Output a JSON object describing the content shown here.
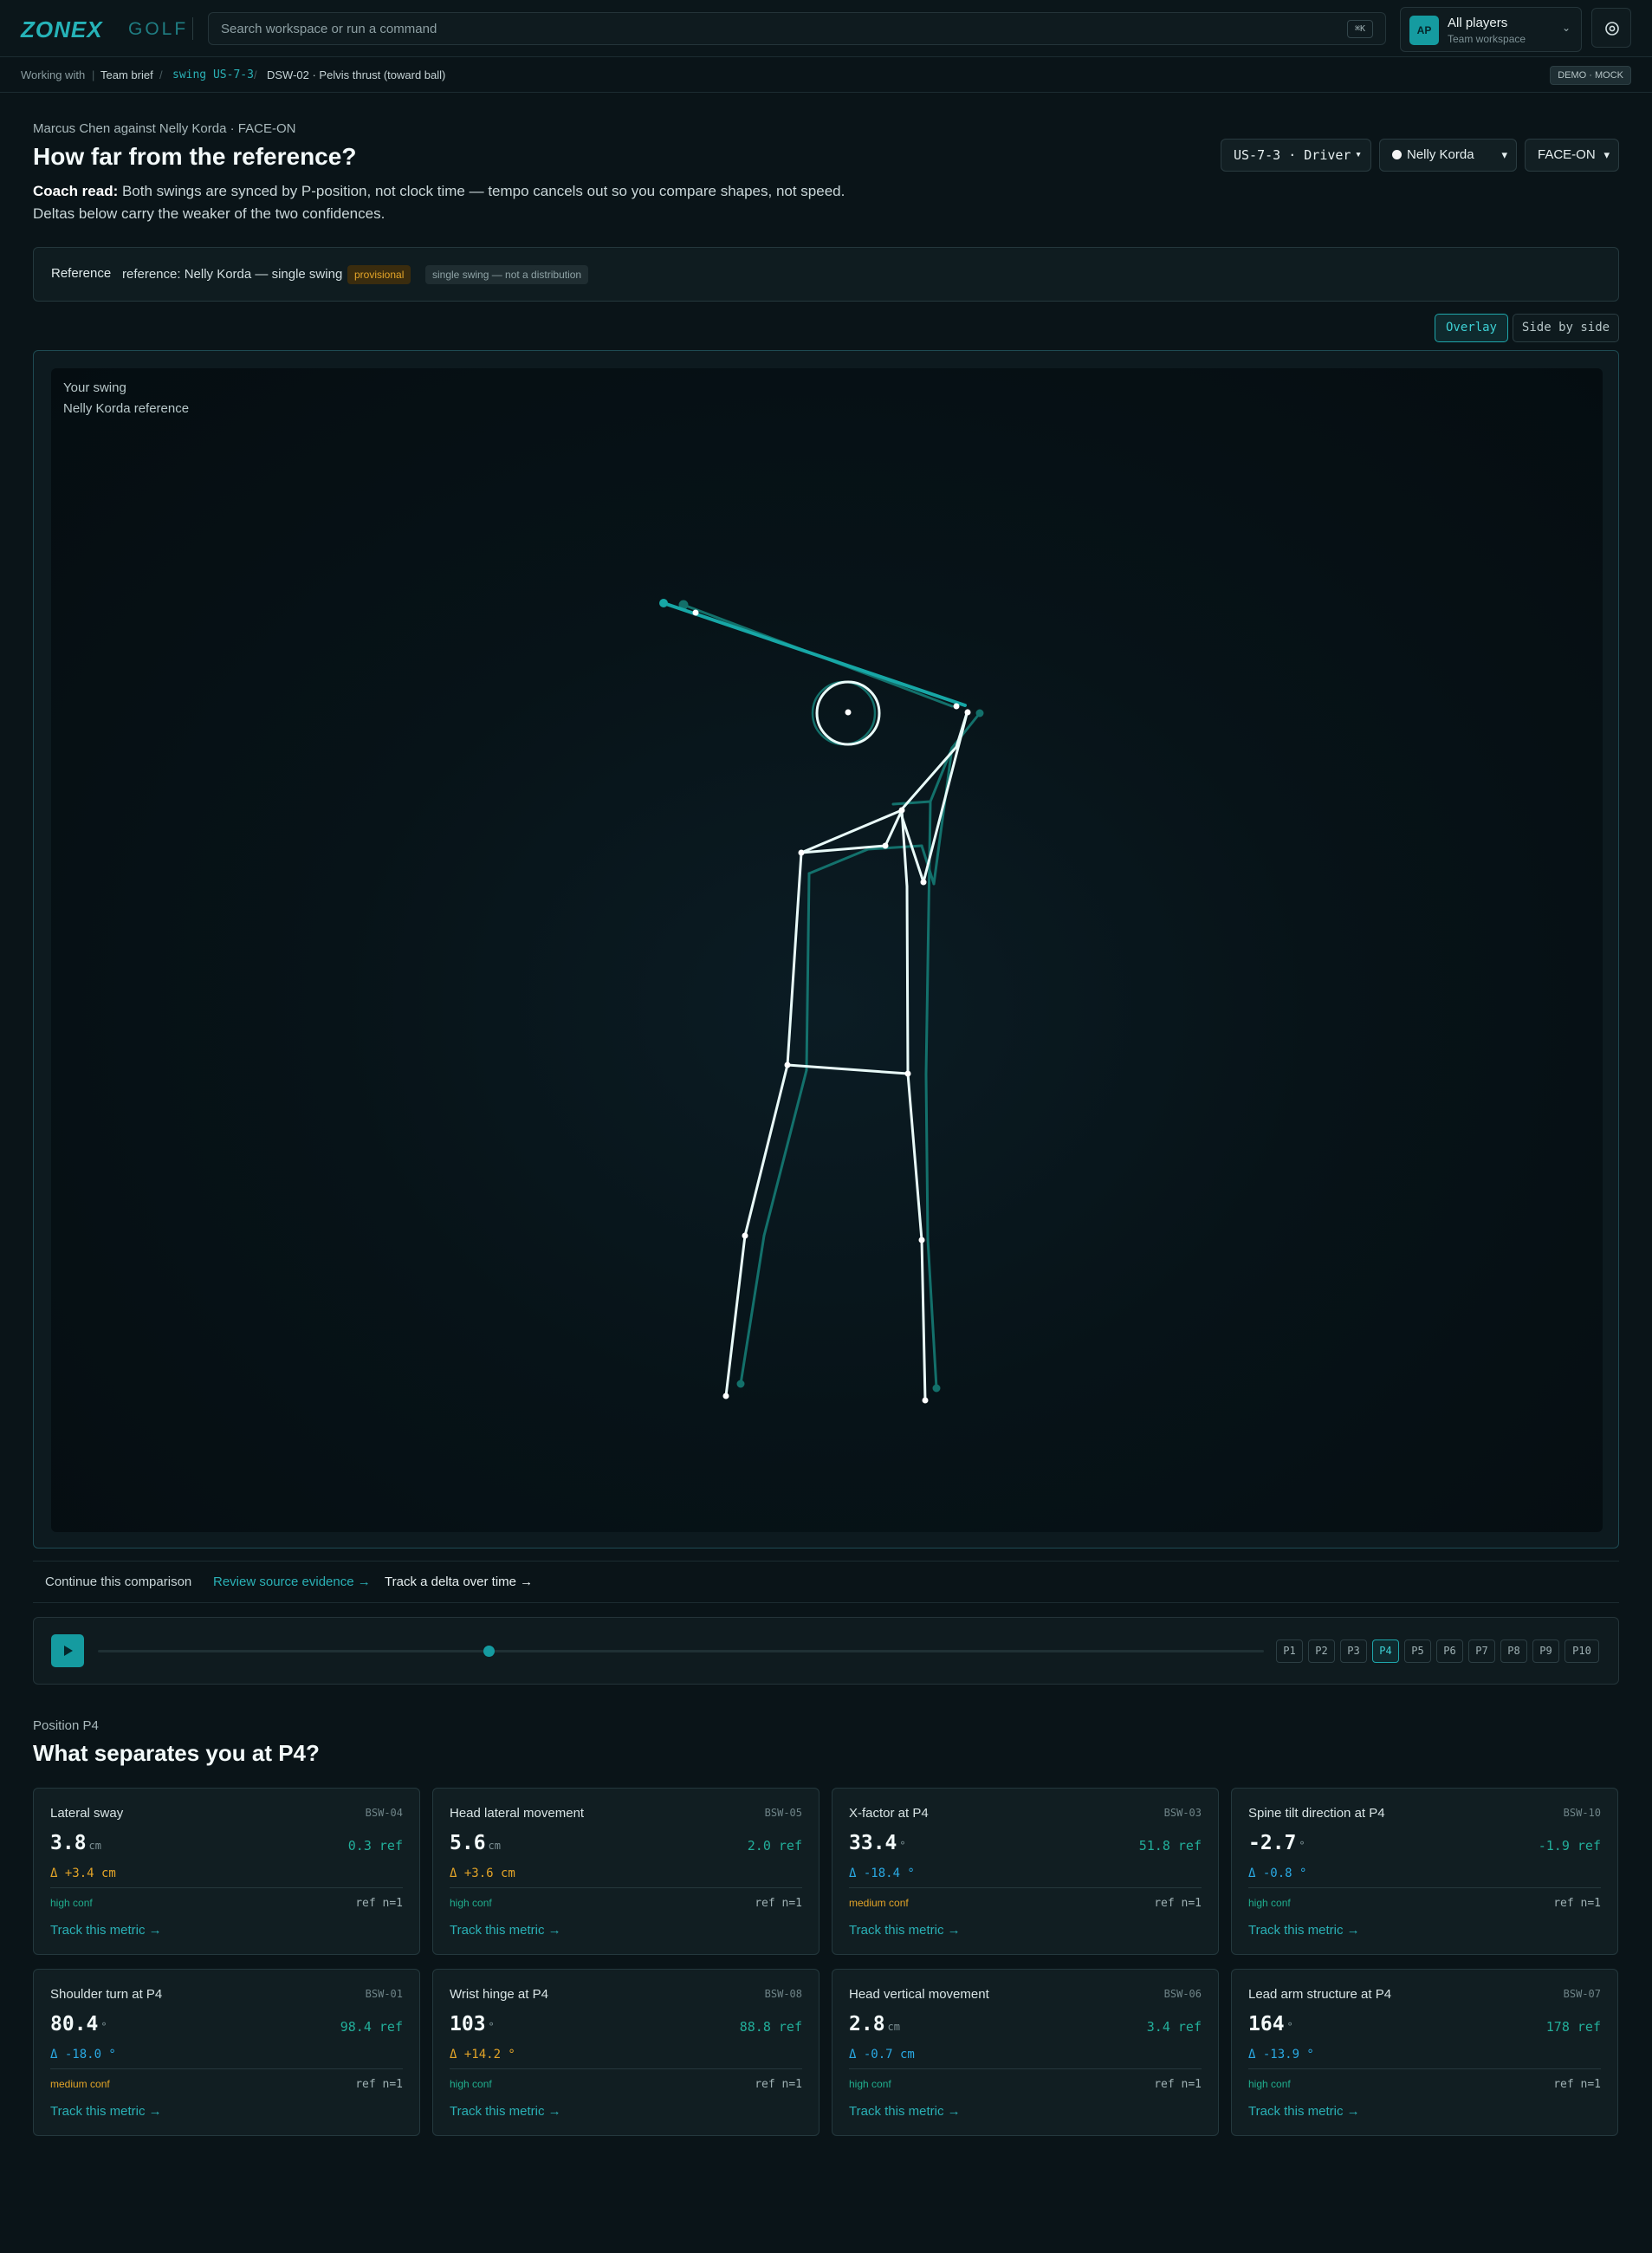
{
  "brand": {
    "logo": "ZONEX",
    "sub": "GOLF"
  },
  "search": {
    "placeholder": "Search workspace or run a command",
    "shortcut": "⌘K"
  },
  "workspace": {
    "avatar": "AP",
    "name": "All players",
    "sub": "Team workspace"
  },
  "breadcrumb": {
    "working_with": "Working with",
    "items": [
      "Team brief",
      "swing US-7-3",
      "DSW-02 · Pelvis thrust (toward ball)"
    ],
    "separator": "/",
    "badge": "DEMO · MOCK"
  },
  "header": {
    "eyebrow": "Marcus Chen against Nelly Korda · FACE-ON",
    "title": "How far from the reference?",
    "coach_label": "Coach read:",
    "coach_text": " Both swings are synced by P-position, not clock time — tempo cancels out so you compare shapes, not speed. Deltas below carry the weaker of the two confidences."
  },
  "selects": {
    "swing": "US-7-3 · Driver",
    "reference_player": "Nelly Korda",
    "view": "FACE-ON"
  },
  "reference": {
    "label": "Reference",
    "text": "reference: Nelly Korda — single swing",
    "pill_status": "provisional",
    "pill_note": "single swing — not a distribution"
  },
  "view_toggle": {
    "overlay": "Overlay",
    "side_by_side": "Side by side",
    "active": "Overlay"
  },
  "stage": {
    "legend_you": "Your swing",
    "legend_ref": "Nelly Korda reference",
    "colors": {
      "you": "#e9fbf9",
      "ref": "#178f86",
      "club": "#17a7a6"
    }
  },
  "continue": {
    "label": "Continue this comparison",
    "link_evidence": "Review source evidence →",
    "link_track": "Track a delta over time →"
  },
  "timeline": {
    "positions": [
      "P1",
      "P2",
      "P3",
      "P4",
      "P5",
      "P6",
      "P7",
      "P8",
      "P9",
      "P10"
    ],
    "active": "P4",
    "progress": 0.335
  },
  "position_section": {
    "eyebrow": "Position P4",
    "title": "What separates you at P4?"
  },
  "metrics": [
    {
      "title": "Lateral sway",
      "code": "BSW-04",
      "value": "3.8",
      "unit": "cm",
      "ref": "0.3 ref",
      "delta": "Δ +3.4 cm",
      "delta_tone": "warn",
      "conf": "high conf",
      "conf_level": "high",
      "n": "ref n=1",
      "track": "Track this metric →"
    },
    {
      "title": "Head lateral movement",
      "code": "BSW-05",
      "value": "5.6",
      "unit": "cm",
      "ref": "2.0 ref",
      "delta": "Δ +3.6 cm",
      "delta_tone": "warn",
      "conf": "high conf",
      "conf_level": "high",
      "n": "ref n=1",
      "track": "Track this metric →"
    },
    {
      "title": "X-factor at P4",
      "code": "BSW-03",
      "value": "33.4",
      "unit": "°",
      "ref": "51.8 ref",
      "delta": "Δ -18.4 °",
      "delta_tone": "info",
      "conf": "medium conf",
      "conf_level": "medium",
      "n": "ref n=1",
      "track": "Track this metric →"
    },
    {
      "title": "Spine tilt direction at P4",
      "code": "BSW-10",
      "value": "-2.7",
      "unit": "°",
      "ref": "-1.9 ref",
      "delta": "Δ -0.8 °",
      "delta_tone": "info",
      "conf": "high conf",
      "conf_level": "high",
      "n": "ref n=1",
      "track": "Track this metric →"
    },
    {
      "title": "Shoulder turn at P4",
      "code": "BSW-01",
      "value": "80.4",
      "unit": "°",
      "ref": "98.4 ref",
      "delta": "Δ -18.0 °",
      "delta_tone": "info",
      "conf": "medium conf",
      "conf_level": "medium",
      "n": "ref n=1",
      "track": "Track this metric →"
    },
    {
      "title": "Wrist hinge at P4",
      "code": "BSW-08",
      "value": "103",
      "unit": "°",
      "ref": "88.8 ref",
      "delta": "Δ +14.2 °",
      "delta_tone": "warn",
      "conf": "high conf",
      "conf_level": "high",
      "n": "ref n=1",
      "track": "Track this metric →"
    },
    {
      "title": "Head vertical movement",
      "code": "BSW-06",
      "value": "2.8",
      "unit": "cm",
      "ref": "3.4 ref",
      "delta": "Δ -0.7 cm",
      "delta_tone": "info",
      "conf": "high conf",
      "conf_level": "high",
      "n": "ref n=1",
      "track": "Track this metric →"
    },
    {
      "title": "Lead arm structure at P4",
      "code": "BSW-07",
      "value": "164",
      "unit": "°",
      "ref": "178 ref",
      "delta": "Δ -13.9 °",
      "delta_tone": "info",
      "conf": "high conf",
      "conf_level": "high",
      "n": "ref n=1",
      "track": "Track this metric →"
    }
  ]
}
